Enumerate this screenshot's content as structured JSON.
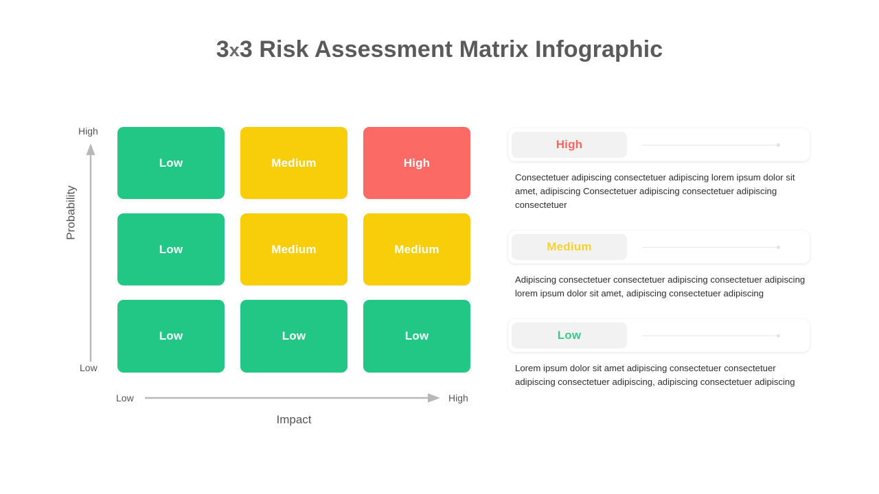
{
  "title": {
    "prefix": "3",
    "x": "x",
    "suffix": "3 Risk Assessment Matrix Infographic",
    "full": "3x3 Risk Assessment Matrix Infographic"
  },
  "axes": {
    "y_title": "Probability",
    "y_high": "High",
    "y_low": "Low",
    "x_title": "Impact",
    "x_low": "Low",
    "x_high": "High"
  },
  "colors": {
    "green": "#22c786",
    "yellow": "#f8ce0b",
    "red": "#fc6a66",
    "label_green": "#3dc98a",
    "label_yellow": "#f5d230",
    "label_red": "#f9655f",
    "title_gray": "#5a5a5a",
    "axis_gray": "#b5b5b5",
    "pill_bg": "#f2f2f2"
  },
  "chart_data": {
    "type": "heatmap",
    "title": "3x3 Risk Assessment Matrix Infographic",
    "xlabel": "Impact",
    "ylabel": "Probability",
    "x_categories": [
      "Low",
      "Medium",
      "High"
    ],
    "y_categories": [
      "Low",
      "Medium",
      "High"
    ],
    "grid": false,
    "legend_position": "right",
    "cells": [
      {
        "row": 0,
        "col": 0,
        "label": "Low",
        "level": "low",
        "color": "#22c786"
      },
      {
        "row": 0,
        "col": 1,
        "label": "Medium",
        "level": "medium",
        "color": "#f8ce0b"
      },
      {
        "row": 0,
        "col": 2,
        "label": "High",
        "level": "high",
        "color": "#fc6a66"
      },
      {
        "row": 1,
        "col": 0,
        "label": "Low",
        "level": "low",
        "color": "#22c786"
      },
      {
        "row": 1,
        "col": 1,
        "label": "Medium",
        "level": "medium",
        "color": "#f8ce0b"
      },
      {
        "row": 1,
        "col": 2,
        "label": "Medium",
        "level": "medium",
        "color": "#f8ce0b"
      },
      {
        "row": 2,
        "col": 0,
        "label": "Low",
        "level": "low",
        "color": "#22c786"
      },
      {
        "row": 2,
        "col": 1,
        "label": "Low",
        "level": "low",
        "color": "#22c786"
      },
      {
        "row": 2,
        "col": 2,
        "label": "Low",
        "level": "low",
        "color": "#22c786"
      }
    ]
  },
  "matrix": {
    "cells": [
      {
        "label": "Low",
        "color": "#22c786"
      },
      {
        "label": "Medium",
        "color": "#f8ce0b"
      },
      {
        "label": "High",
        "color": "#fc6a66"
      },
      {
        "label": "Low",
        "color": "#22c786"
      },
      {
        "label": "Medium",
        "color": "#f8ce0b"
      },
      {
        "label": "Medium",
        "color": "#f8ce0b"
      },
      {
        "label": "Low",
        "color": "#22c786"
      },
      {
        "label": "Low",
        "color": "#22c786"
      },
      {
        "label": "Low",
        "color": "#22c786"
      }
    ]
  },
  "legend": {
    "items": [
      {
        "label": "High",
        "label_color": "#f9655f",
        "description": "Consectetuer adipiscing consectetuer adipiscing lorem ipsum dolor sit amet, adipiscing Consectetuer adipiscing consectetuer adipiscing consectetuer"
      },
      {
        "label": "Medium",
        "label_color": "#f5d230",
        "description": "Adipiscing consectetuer consectetuer adipiscing consectetuer adipiscing lorem ipsum dolor sit amet, adipiscing consectetuer adipiscing"
      },
      {
        "label": "Low",
        "label_color": "#3dc98a",
        "description": "Lorem ipsum dolor sit amet adipiscing consectetuer consectetuer adipiscing consectetuer adipiscing, adipiscing consectetuer adipiscing"
      }
    ]
  }
}
